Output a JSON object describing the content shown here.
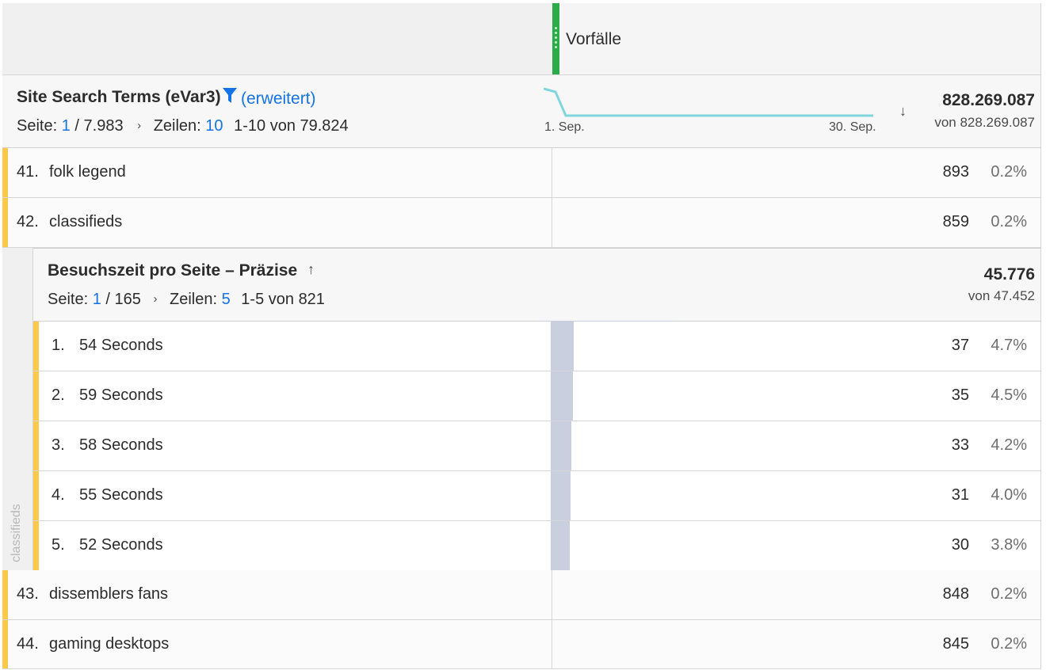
{
  "header": {
    "metric_title": "Vorfälle",
    "metric_color": "#2bab4a"
  },
  "dimension": {
    "title": "Site Search Terms (eVar3)",
    "filter_icon": "filter-icon",
    "advanced_label": "(erweitert)",
    "page_label": "Seite:",
    "page_current": "1",
    "page_total": "/ 7.983",
    "rows_label": "Zeilen:",
    "rows_count": "10",
    "range": "1-10 von 79.824",
    "spark_start": "1. Sep.",
    "spark_end": "30. Sep.",
    "sort_icon": "arrow-down-icon",
    "total_value": "828.269.087",
    "total_sub": "von 828.269.087"
  },
  "rows_top": [
    {
      "num": "41.",
      "label": "folk legend",
      "value": "893",
      "pct": "0.2%"
    },
    {
      "num": "42.",
      "label": "classifieds",
      "value": "859",
      "pct": "0.2%"
    }
  ],
  "breakdown": {
    "side_label": "classifieds",
    "title": "Besuchszeit pro Seite – Präzise",
    "sort_icon": "arrow-up-icon",
    "page_label": "Seite:",
    "page_current": "1",
    "page_total": "/ 165",
    "rows_label": "Zeilen:",
    "rows_count": "5",
    "range": "1-5 von 821",
    "total_value": "45.776",
    "total_sub": "von 47.452",
    "rows": [
      {
        "num": "1.",
        "label": "54 Seconds",
        "value": "37",
        "pct": "4.7%",
        "fill": 0.047
      },
      {
        "num": "2.",
        "label": "59 Seconds",
        "value": "35",
        "pct": "4.5%",
        "fill": 0.045
      },
      {
        "num": "3.",
        "label": "58 Seconds",
        "value": "33",
        "pct": "4.2%",
        "fill": 0.042
      },
      {
        "num": "4.",
        "label": "55 Seconds",
        "value": "31",
        "pct": "4.0%",
        "fill": 0.04
      },
      {
        "num": "5.",
        "label": "52 Seconds",
        "value": "30",
        "pct": "3.8%",
        "fill": 0.038
      }
    ]
  },
  "rows_bottom": [
    {
      "num": "43.",
      "label": "dissemblers fans",
      "value": "848",
      "pct": "0.2%"
    },
    {
      "num": "44.",
      "label": "gaming desktops",
      "value": "845",
      "pct": "0.2%"
    }
  ],
  "colors": {
    "accent_blue": "#1473e6",
    "row_marker": "#fcc94a",
    "sparkline": "#7fd6dc",
    "percent_bar": "#c9cfde"
  }
}
